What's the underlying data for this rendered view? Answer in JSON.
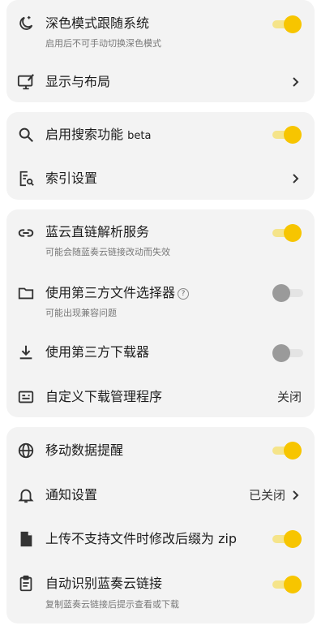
{
  "groups": {
    "display": {
      "dark_mode": {
        "title": "深色模式跟随系统",
        "subtitle": "启用后不可手动切换深色模式",
        "enabled": true,
        "icon": "moon-stars-icon"
      },
      "layout": {
        "title": "显示与布局",
        "icon": "monitor-brush-icon"
      }
    },
    "search": {
      "enable": {
        "title": "启用搜索功能",
        "badge": "beta",
        "enabled": true,
        "icon": "search-icon"
      },
      "index": {
        "title": "索引设置",
        "icon": "index-search-icon"
      }
    },
    "download": {
      "direct_link": {
        "title": "蓝云直链解析服务",
        "subtitle": "可能会随蓝奏云链接改动而失效",
        "enabled": true,
        "icon": "link-icon"
      },
      "file_picker": {
        "title": "使用第三方文件选择器",
        "subtitle": "可能出现兼容问题",
        "enabled": false,
        "icon": "folder-icon",
        "help": "?"
      },
      "downloader": {
        "title": "使用第三方下载器",
        "enabled": false,
        "icon": "download-icon"
      },
      "manager": {
        "title": "自定义下载管理程序",
        "value": "关闭",
        "icon": "card-icon"
      }
    },
    "misc": {
      "mobile_data": {
        "title": "移动数据提醒",
        "enabled": true,
        "icon": "globe-icon"
      },
      "notification": {
        "title": "通知设置",
        "value": "已关闭",
        "icon": "bell-icon"
      },
      "upload_suffix": {
        "title": "上传不支持文件时修改后缀为 zip",
        "enabled": true,
        "icon": "file-icon"
      },
      "auto_detect": {
        "title": "自动识别蓝奏云链接",
        "subtitle": "复制蓝奏云链接后提示查看或下载",
        "enabled": true,
        "icon": "clipboard-icon"
      }
    }
  },
  "colors": {
    "accent": "#f7c500",
    "accent_track": "#f5e48a",
    "card_bg": "#f3f3f3"
  }
}
